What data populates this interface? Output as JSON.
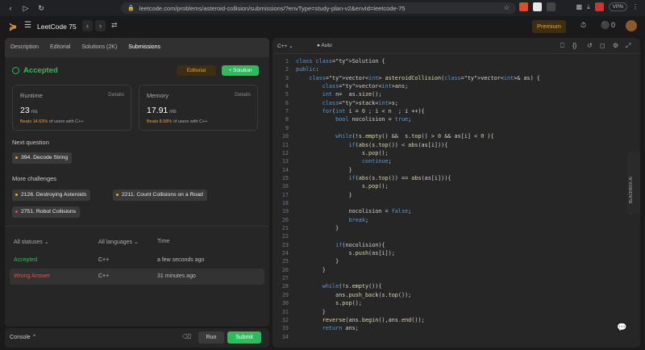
{
  "browser": {
    "url": "leetcode.com/problems/asteroid-collision/submissions/?envType=study-plan-v2&envId=leetcode-75",
    "vpn": "VPN"
  },
  "topbar": {
    "title": "LeetCode 75",
    "premium": "Premium",
    "streak": "0"
  },
  "tabs": [
    "Description",
    "Editorial",
    "Solutions (2K)",
    "Submissions"
  ],
  "result": {
    "status": "Accepted",
    "editorial_btn": "Editorial",
    "solution_btn": "+ Solution"
  },
  "runtime": {
    "label": "Runtime",
    "details": "Details",
    "value": "23",
    "unit": "ms",
    "beats": "Beats 14.63%",
    "suffix": "of users with C++"
  },
  "memory": {
    "label": "Memory",
    "details": "Details",
    "value": "17.91",
    "unit": "mb",
    "beats": "Beats 8.58%",
    "suffix": "of users with C++"
  },
  "next_question": {
    "label": "Next question",
    "item": "394. Decode String",
    "color": "#f0a12a"
  },
  "more_challenges": {
    "label": "More challenges",
    "items": [
      {
        "text": "2126. Destroying Asteroids",
        "color": "#f0a12a"
      },
      {
        "text": "2211. Count Collisions on a Road",
        "color": "#f0a12a"
      },
      {
        "text": "2751. Robot Collisions",
        "color": "#ef4743"
      }
    ]
  },
  "submissions": {
    "headers": [
      "All statuses",
      "All languages",
      "Time"
    ],
    "rows": [
      {
        "status": "Accepted",
        "lang": "C++",
        "time": "a few seconds ago",
        "color": "#2cbb5d"
      },
      {
        "status": "Wrong Answer",
        "lang": "C++",
        "time": "31 minutes ago",
        "color": "#ef4743"
      }
    ]
  },
  "console": {
    "label": "Console",
    "run": "Run",
    "submit": "Submit"
  },
  "editor": {
    "language": "C++",
    "mode": "Auto",
    "blackbox": "BLACKBOX AI",
    "lines": [
      "class Solution {",
      "public:",
      "    vector<int> asteroidCollision(vector<int>& as) {",
      "        vector<int>ans;",
      "        int n=  as.size();",
      "        stack<int>s;",
      "        for(int i = 0 ; i < n  ; i ++){",
      "            bool nocolision = true;",
      "",
      "            while(!s.empty() &&  s.top() > 0 && as[i] < 0 ){",
      "                if(abs(s.top()) < abs(as[i])){",
      "                    s.pop();",
      "                    continue;",
      "                }",
      "                if(abs(s.top()) == abs(as[i])){",
      "                    s.pop();",
      "                }",
      "",
      "                nocolision = false;",
      "                break;",
      "            }",
      "",
      "            if(nocolision){",
      "                s.push(as[i]);",
      "            }",
      "        }",
      "",
      "        while(!s.empty()){",
      "            ans.push_back(s.top());",
      "            s.pop();",
      "        }",
      "        reverse(ans.begin(),ans.end());",
      "        return ans;",
      ""
    ]
  }
}
